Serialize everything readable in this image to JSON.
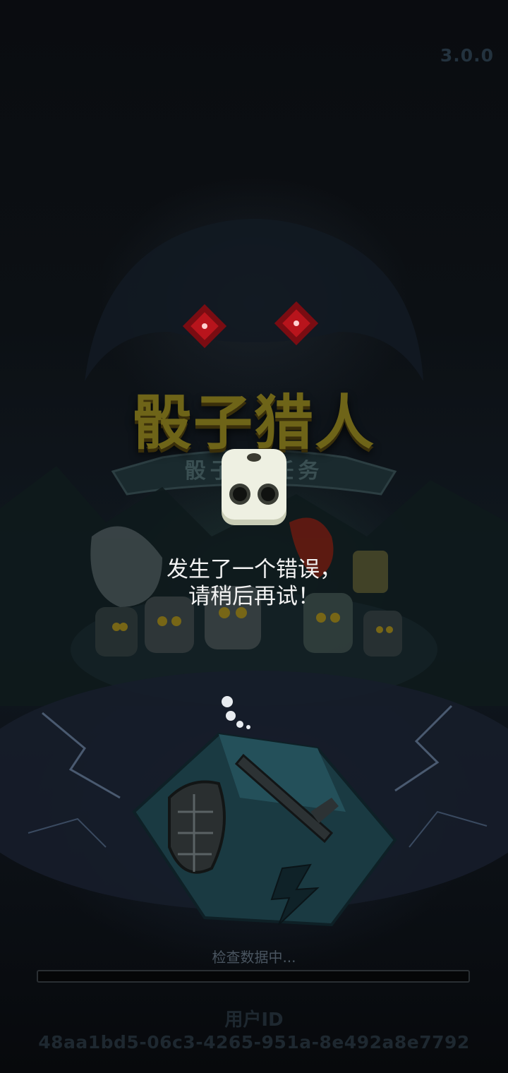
{
  "app": {
    "version": "3.0.0",
    "title_logo": "骰子猎人",
    "subtitle_logo": "骰子 的任务"
  },
  "dialog": {
    "error_line1": "发生了一个错误，",
    "error_line2": "请稍后再试！"
  },
  "loading": {
    "status": "检查数据中...",
    "progress": 0
  },
  "user": {
    "id_label": "用户ID",
    "id_value": "48aa1bd5-06c3-4265-951a-8e492a8e7792"
  },
  "icons": {
    "loading_indicator": "dice-face-icon",
    "foreground_dice": "shield-sword-dice-icon",
    "eyes": "red-dice-eyes-icon"
  },
  "colors": {
    "background": "#0b0e12",
    "title_gold": "#6e6418",
    "message_text": "#f2f2f2",
    "muted_text": "#4a5560",
    "eye_red": "#b8141c"
  }
}
